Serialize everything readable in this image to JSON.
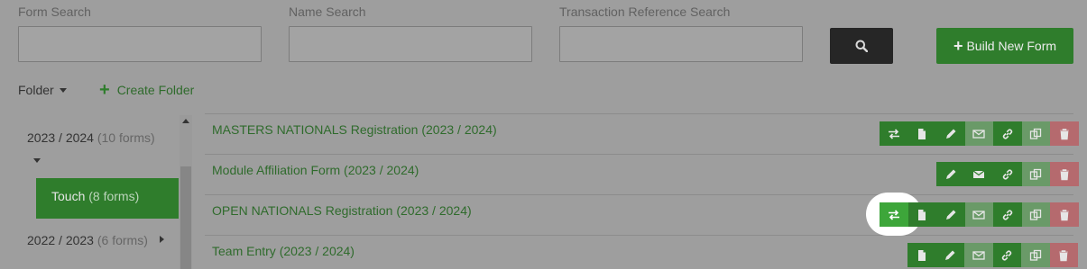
{
  "search": {
    "form_label": "Form Search",
    "name_label": "Name Search",
    "txn_label": "Transaction Reference Search",
    "form_value": "",
    "name_value": "",
    "txn_value": ""
  },
  "toolbar": {
    "build_label": "Build New Form",
    "folder_label": "Folder",
    "create_folder_label": "Create Folder"
  },
  "folders": [
    {
      "name": "2023 / 2024",
      "count": "(10 forms)"
    },
    {
      "name": "Touch",
      "count": "(8 forms)"
    },
    {
      "name": "2022 / 2023",
      "count": "(6 forms)"
    }
  ],
  "forms": [
    {
      "title": "MASTERS NATIONALS Registration (2023 / 2024)"
    },
    {
      "title": "Module Affiliation Form (2023 / 2024)"
    },
    {
      "title": "OPEN NATIONALS Registration (2023 / 2024)"
    },
    {
      "title": "Team Entry (2023 / 2024)"
    }
  ],
  "colors": {
    "primary_green": "#2f7d2c",
    "delete_red": "#b56a6e",
    "dark": "#262626"
  },
  "icons": [
    "search-icon",
    "transfer-icon",
    "document-icon",
    "pencil-icon",
    "envelope-icon",
    "link-icon",
    "copy-icon",
    "trash-icon"
  ]
}
